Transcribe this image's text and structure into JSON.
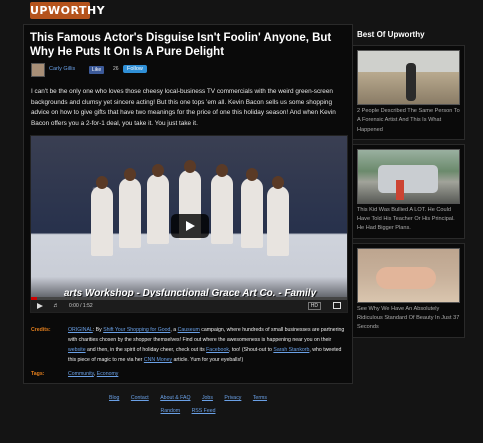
{
  "site": {
    "logo": "UPWORTHY"
  },
  "article": {
    "title": "This Famous Actor's Disguise Isn't Foolin' Anyone, But Why He Puts It On Is A Pure Delight",
    "author": "Carly Gillis",
    "fb_like": "Like",
    "fb_count": "26",
    "tw_follow": "Follow",
    "intro": "I can't be the only one who loves those cheesy local-business TV commercials with the weird green-screen backgrounds and clumsy yet sincere acting! But this one tops 'em all. Kevin Bacon sells us some shopping advice on how to give gifts that have two meanings for the price of one this holiday season! And when Kevin Bacon offers you a 2-for-1 deal, you take it. You just take it."
  },
  "video": {
    "caption": "arts Workshop - Dysfunctional Grace Art Co. - Family",
    "time": "0:00 / 1:52",
    "hd_label": "HD",
    "progress_fraction": 0.02
  },
  "credits": {
    "label": "Credits:",
    "original_prefix": "ORIGINAL",
    "by_text": ": By ",
    "shift_link": "Shift Your Shopping for Good",
    "mid1": ", a ",
    "causeum_link": "Causeum",
    "mid2": " campaign, where hundreds of small businesses are partnering with charities chosen by the shopper themselves! Find out where the awesomeness is happening near you on their ",
    "website_link": "website",
    "mid3": " and then, in the spirit of holiday cheer, check out its ",
    "facebook_link": "Facebook",
    "mid4": ", too! (Shout-out to ",
    "sarah_link": "Sarah Stankorb",
    "mid5": ", who tweeted this piece of magic to me via her ",
    "cnn_link": "CNN Money",
    "mid6": " article. Yum for your eyeballs!)"
  },
  "tags": {
    "label": "Tags:",
    "items": [
      "Community",
      "Economy"
    ],
    "separator": ", "
  },
  "footer": {
    "links": [
      "Blog",
      "Contact",
      "About & FAQ",
      "Jobs",
      "Privacy",
      "Terms"
    ],
    "links2": [
      "Random",
      "RSS Feed"
    ]
  },
  "sidebar": {
    "title": "Best Of Upworthy",
    "cards": [
      {
        "text": "2 People Described The Same Person To A Forensic Artist And This Is What Happened"
      },
      {
        "text": "This Kid Was Bullied A LOT. He Could Have Told His Teacher Or His Principal. He Had Bigger Plans."
      },
      {
        "text": "See Why We Have An Absolutely Ridiculous Standard Of Beauty In Just 37 Seconds"
      }
    ]
  }
}
